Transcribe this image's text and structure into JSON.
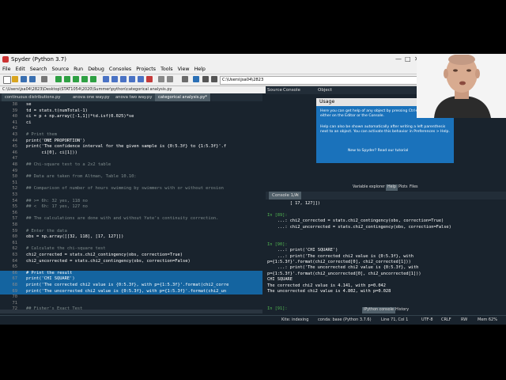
{
  "window": {
    "title": "Spyder (Python 3.7)"
  },
  "menu": [
    "File",
    "Edit",
    "Search",
    "Source",
    "Run",
    "Debug",
    "Consoles",
    "Projects",
    "Tools",
    "View",
    "Help"
  ],
  "path": "C:\\Users\\jsa04\\2823",
  "breadcrumb": "C:\\Users\\jsa04\\2823\\Desktop\\STAT1054\\2020\\Summer\\python\\categorical analysis.py",
  "editor_tabs": [
    "continuous distributions.py",
    "anova one way.py",
    "anova two way.py",
    "categorical analysis.py*"
  ],
  "code_lines": [
    {
      "n": "38",
      "t": "se"
    },
    {
      "n": "39",
      "t": "td = stats.t(numTotal-1)"
    },
    {
      "n": "40",
      "t": "ci = p + np.array([-1,1])*td.isf(0.025)*se"
    },
    {
      "n": "41",
      "t": "ci"
    },
    {
      "n": "42",
      "t": ""
    },
    {
      "n": "43",
      "t": "# Print them",
      "c": 1
    },
    {
      "n": "44",
      "t": "print('ONE PROPORTION')"
    },
    {
      "n": "45",
      "t": "print('The confidence interval for the given sample is {0:5.3f} to {1:5.3f}'.f"
    },
    {
      "n": "46",
      "t": "      ci[0], ci[1]))"
    },
    {
      "n": "47",
      "t": ""
    },
    {
      "n": "48",
      "t": "## Chi-square test to a 2x2 table",
      "c": 1
    },
    {
      "n": "49",
      "t": ""
    },
    {
      "n": "50",
      "t": "## Data are taken from Altman, Table 10.10:",
      "c": 1
    },
    {
      "n": "51",
      "t": ""
    },
    {
      "n": "52",
      "t": "## Comparison of number of hours swimming by swimmers with or without erosion",
      "c": 1
    },
    {
      "n": "53",
      "t": ""
    },
    {
      "n": "54",
      "t": "## >= 6h: 32 yes, 118 no",
      "c": 1
    },
    {
      "n": "55",
      "t": "## <  6h: 17 yes, 127 no",
      "c": 1
    },
    {
      "n": "56",
      "t": ""
    },
    {
      "n": "57",
      "t": "## The calculations are done with and without Yate's continuity correction.",
      "c": 1
    },
    {
      "n": "58",
      "t": ""
    },
    {
      "n": "59",
      "t": "# Enter the data",
      "c": 1
    },
    {
      "n": "60",
      "t": "obs = np.array([[32, 118], [17, 127]])"
    },
    {
      "n": "61",
      "t": ""
    },
    {
      "n": "62",
      "t": "# Calculate the chi-square test",
      "c": 1
    },
    {
      "n": "63",
      "t": "chi2_corrected = stats.chi2_contingency(obs, correction=True)"
    },
    {
      "n": "64",
      "t": "chi2_uncorrected = stats.chi2_contingency(obs, correction=False)"
    },
    {
      "n": "65",
      "t": ""
    },
    {
      "n": "66",
      "t": "# Print the result",
      "s": 1,
      "c": 1
    },
    {
      "n": "67",
      "t": "print('CHI SQUARE')",
      "s": 1
    },
    {
      "n": "68",
      "t": "print('The corrected chi2 value is {0:5.3f}, with p={1:5.3f}'.format(chi2_corre",
      "s": 1
    },
    {
      "n": "69",
      "t": "print('The uncorrected chi2 value is {0:5.3f}, with p={1:5.3f}'.format(chi2_un",
      "s": 1
    },
    {
      "n": "70",
      "t": ""
    },
    {
      "n": "71",
      "t": ""
    },
    {
      "n": "72",
      "t": "## Fisher's Exact Test",
      "c": 1
    }
  ],
  "help": {
    "tabs": [
      "Source",
      "Console",
      "Object"
    ],
    "usage_title": "Usage",
    "p1": "Here you can get help of any object by pressing Ctrl+I in front of it, either on the Editor or the Console.",
    "p2": "Help can also be shown automatically after writing a left parenthesis next to an object. You can activate this behavior in Preferences > Help.",
    "p3": "New to Spyder? Read our tutorial",
    "bottom_tabs": [
      "Variable explorer",
      "Help",
      "Plots",
      "Files"
    ]
  },
  "console": {
    "tab": "Console 1/A",
    "lines": [
      {
        "t": "         [ 17, 127]])"
      },
      {
        "t": ""
      },
      {
        "t": "In [89]:",
        "k": "grn"
      },
      {
        "t": "    ...: chi2_corrected = stats.chi2_contingency(obs, correction=True)"
      },
      {
        "t": "    ...: chi2_uncorrected = stats.chi2_contingency(obs, correction=False)"
      },
      {
        "t": ""
      },
      {
        "t": ""
      },
      {
        "t": "In [90]:",
        "k": "grn"
      },
      {
        "t": "    ...: print('CHI SQUARE')"
      },
      {
        "t": "    ...: print('The corrected chi2 value is {0:5.3f}, with"
      },
      {
        "t": "p={1:5.3f}'.format(chi2_corrected[0], chi2_corrected[1]))"
      },
      {
        "t": "    ...: print('The uncorrected chi2 value is {0:5.3f}, with"
      },
      {
        "t": "p={1:5.3f}'.format(chi2_uncorrected[0], chi2_uncorrected[1]))"
      },
      {
        "t": "CHI SQUARE"
      },
      {
        "t": "The corrected chi2 value is 4.141, with p=0.042"
      },
      {
        "t": "The uncorrected chi2 value is 4.802, with p=0.028"
      },
      {
        "t": ""
      },
      {
        "t": ""
      },
      {
        "t": "In [91]:",
        "k": "grn"
      }
    ],
    "bottom_tabs": [
      "IPython console",
      "History"
    ]
  },
  "status": [
    "Kite: indexing",
    "conda: base (Python 3.7.6)",
    "Line 71, Col 1",
    "UTF-8",
    "CRLF",
    "RW",
    "Mem 62%"
  ]
}
